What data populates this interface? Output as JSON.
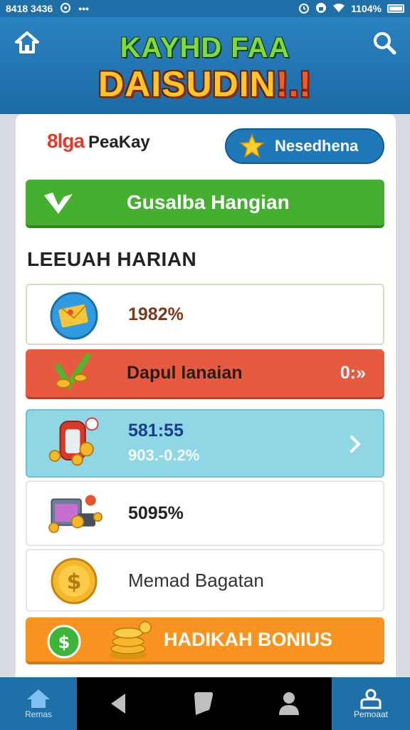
{
  "status_bar": {
    "time": "8418 3436",
    "battery": "1104%"
  },
  "header": {
    "title_line1": "KAYHD FAA",
    "title_line2": "DAISUDIN",
    "title_line2_suffix": "!.!"
  },
  "brand": {
    "logo_text": "8lga",
    "logo_sub": "PeaKay"
  },
  "top_button": {
    "label": "Nesedhena"
  },
  "daily_button": {
    "label": "Gusalba Hangian"
  },
  "section": {
    "title": "LEEUAH HARIAN"
  },
  "rows": [
    {
      "value": "1982%"
    },
    {
      "value": "Dapul lanaian",
      "right": "0:»"
    },
    {
      "value": "581:55",
      "sub": "903.-0.2%"
    },
    {
      "value": "5095%"
    },
    {
      "value": "Memad Bagatan"
    },
    {
      "value": "HADIKAH BONIUS"
    }
  ],
  "bottom_nav": {
    "left_label": "Remas",
    "right_label": "Pemoaat"
  },
  "colors": {
    "header_blue": "#2a82c0",
    "green_button": "#45b02f",
    "orange_red_row": "#e65b40",
    "cyan_row": "#8fd7e4",
    "bonus_orange": "#f7931e"
  }
}
